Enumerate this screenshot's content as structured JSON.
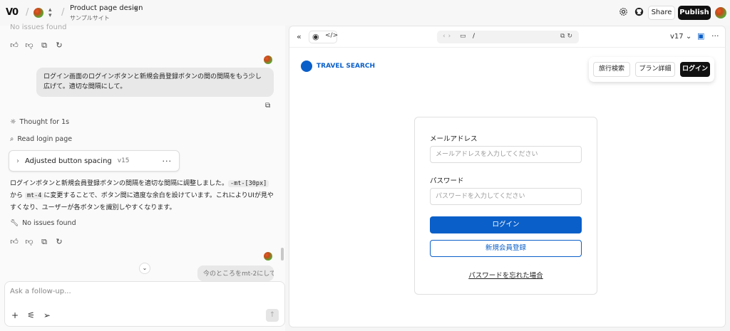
{
  "topbar": {
    "logo": "V0",
    "project_title": "Product page design",
    "project_subtitle": "サンプルサイト",
    "share_label": "Share",
    "publish_label": "Publish"
  },
  "chat": {
    "faded_status": "No issues found",
    "user_message": "ログイン画面のログインボタンと新規会員登録ボタンの間の間隔をもう少し広げて。適切な間隔にして。",
    "thought": "Thought for 1s",
    "read_file": "Read login page",
    "card_title": "Adjusted button spacing",
    "card_version": "v15",
    "explain_part1": "ログインボタンと新規会員登録ボタンの間隔を適切な間隔に調整しました。",
    "code_old": "-mt-[30px]",
    "explain_from": "から",
    "code_new": "mt-4",
    "explain_part2": "に変更することで、ボタン間に適度な余白を設けています。これによりUIが見やすくなり、ユーザーが各ボタンを識別しやすくなります。",
    "no_issues": "No issues found",
    "user_message2": "今のところをmt-2にして。",
    "composer_placeholder": "Ask a follow-up..."
  },
  "preview": {
    "url_path": "/",
    "version": "v17",
    "brand": "TRAVEL SEARCH",
    "nav": [
      "旅行検索",
      "プラン詳細",
      "ログイン"
    ],
    "email_label": "メールアドレス",
    "email_placeholder": "メールアドレスを入力してください",
    "password_label": "パスワード",
    "password_placeholder": "パスワードを入力してください",
    "login_button": "ログイン",
    "register_button": "新規会員登録",
    "forgot_link": "パスワードを忘れた場合"
  },
  "colors": {
    "accent_blue": "#0a5fc9",
    "publish_bg": "#111111"
  },
  "icons": [
    "settings-icon",
    "github-icon",
    "thumbs-up-icon",
    "thumbs-down-icon",
    "copy-icon",
    "refresh-icon",
    "lightbulb-icon",
    "search-icon",
    "wrench-icon",
    "plus-icon",
    "sliders-icon",
    "send-icon",
    "eye-icon",
    "code-icon",
    "monitor-icon"
  ]
}
